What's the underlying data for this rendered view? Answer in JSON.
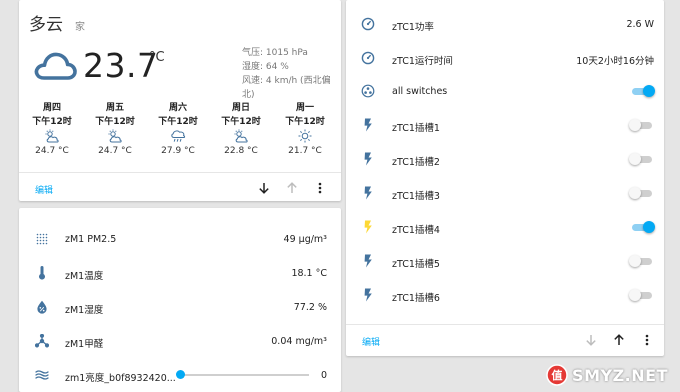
{
  "weather": {
    "condition": "多云",
    "location": "家",
    "temperature": "23.7",
    "unit": "°C",
    "attrs": [
      "气压: 1015 hPa",
      "湿度: 64 %",
      "风速: 4 km/h (西北偏北)"
    ],
    "forecast": [
      {
        "day": "周四",
        "time": "下午12时",
        "temp": "24.7 °C",
        "icon": "partly-cloudy-icon"
      },
      {
        "day": "周五",
        "time": "下午12时",
        "temp": "24.7 °C",
        "icon": "partly-cloudy-icon"
      },
      {
        "day": "周六",
        "time": "下午12时",
        "temp": "27.9 °C",
        "icon": "rainy-icon"
      },
      {
        "day": "周日",
        "time": "下午12时",
        "temp": "22.8 °C",
        "icon": "partly-cloudy-icon"
      },
      {
        "day": "周一",
        "time": "下午12时",
        "temp": "21.7 °C",
        "icon": "sunny-icon"
      }
    ],
    "edit_label": "编辑"
  },
  "sensors": [
    {
      "label": "zM1 PM2.5",
      "value": "49 μg/m³",
      "icon": "grid-dots-icon"
    },
    {
      "label": "zM1温度",
      "value": "18.1 °C",
      "icon": "thermometer-icon"
    },
    {
      "label": "zM1湿度",
      "value": "77.2 %",
      "icon": "water-percent-icon"
    },
    {
      "label": "zM1甲醛",
      "value": "0.04 mg/m³",
      "icon": "molecule-icon"
    },
    {
      "label": "zm1亮度_b0f8932420...",
      "value": "0",
      "icon": "brightness-icon",
      "slider": 0
    }
  ],
  "switches": {
    "rows": [
      {
        "label": "zTC1功率",
        "value": "2.6 W",
        "icon": "gauge-icon",
        "type": "sensor"
      },
      {
        "label": "zTC1运行时间",
        "value": "10天2小时16分钟",
        "icon": "gauge-icon",
        "type": "sensor"
      },
      {
        "label": "all switches",
        "icon": "group-icon",
        "type": "toggle",
        "on": true
      },
      {
        "label": "zTC1插槽1",
        "icon": "flash-icon",
        "type": "toggle",
        "on": false
      },
      {
        "label": "zTC1插槽2",
        "icon": "flash-icon",
        "type": "toggle",
        "on": false
      },
      {
        "label": "zTC1插槽3",
        "icon": "flash-icon",
        "type": "toggle",
        "on": false
      },
      {
        "label": "zTC1插槽4",
        "icon": "flash-icon",
        "type": "toggle",
        "on": true,
        "active": true
      },
      {
        "label": "zTC1插槽5",
        "icon": "flash-icon",
        "type": "toggle",
        "on": false
      },
      {
        "label": "zTC1插槽6",
        "icon": "flash-icon",
        "type": "toggle",
        "on": false
      }
    ],
    "edit_label": "编辑"
  },
  "watermark": {
    "text": "SMYZ.NET",
    "badge": "值"
  },
  "colors": {
    "accent": "#03a9f4",
    "icon": "#44739e",
    "active_icon": "#fdd835",
    "cloud": "#44739e"
  }
}
